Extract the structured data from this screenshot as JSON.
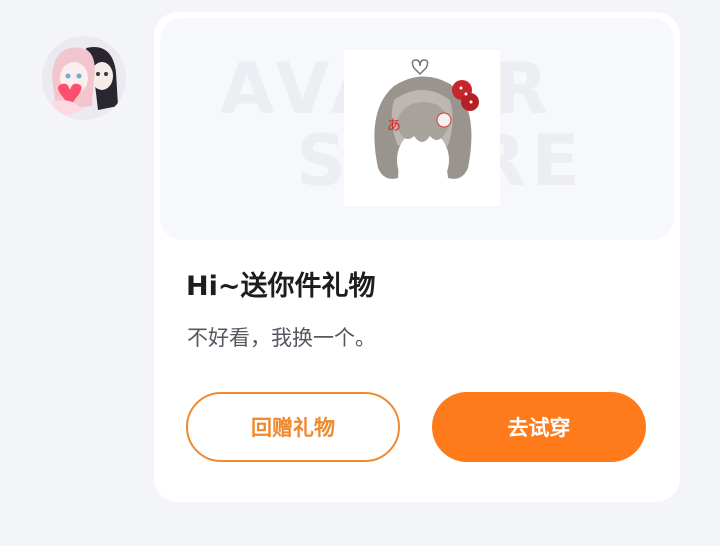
{
  "message": {
    "title": "Hi~送你件礼物",
    "subtitle": "不好看，我换一个。"
  },
  "banner": {
    "watermark_line1": "AVATAR",
    "watermark_line2": "STORE"
  },
  "actions": {
    "return_gift_label": "回赠礼物",
    "try_on_label": "去试穿"
  },
  "colors": {
    "accent": "#ff7a1a",
    "outline_accent": "#ef8a2e",
    "page_bg": "#f4f5f9",
    "card_bg": "#ffffff"
  },
  "icons": {
    "avatar": "anime-pair-avatar",
    "item": "hair-item-icon"
  }
}
